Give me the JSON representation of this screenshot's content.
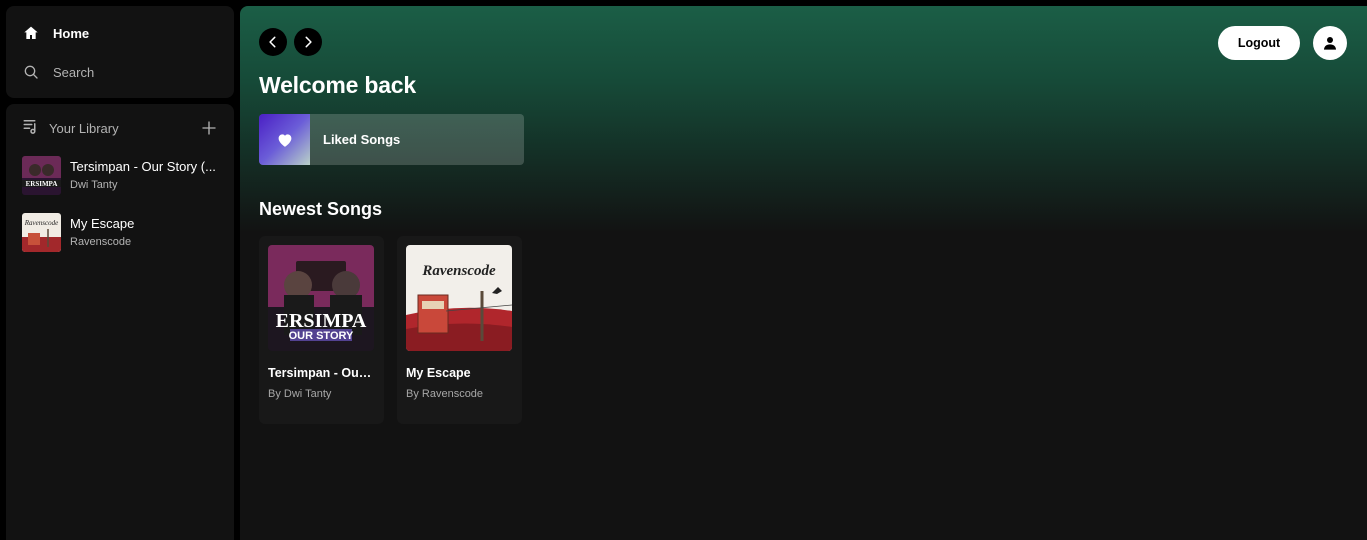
{
  "sidebar": {
    "nav": {
      "home_label": "Home",
      "search_label": "Search"
    },
    "library": {
      "title": "Your Library",
      "items": [
        {
          "title": "Tersimpan - Our Story (...",
          "subtitle": "Dwi Tanty",
          "thumb_text": "ERSIMPA"
        },
        {
          "title": "My Escape",
          "subtitle": "Ravenscode",
          "thumb_text": "Ravenscode"
        }
      ]
    }
  },
  "header": {
    "logout_label": "Logout"
  },
  "main": {
    "greeting": "Welcome back",
    "liked_songs_label": "Liked Songs",
    "newest_title": "Newest Songs",
    "songs": [
      {
        "title": "Tersimpan - Our ...",
        "by": "By Dwi Tanty",
        "art_text_main": "ERSIMPA",
        "art_text_sub": "OUR STORY"
      },
      {
        "title": "My Escape",
        "by": "By Ravenscode",
        "art_text_main": "Ravenscode"
      }
    ]
  },
  "colors": {
    "accent_green": "#1b5e46",
    "surface": "#121212",
    "card": "#181818",
    "muted_text": "#b3b3b3"
  },
  "icons": [
    "home-icon",
    "search-icon",
    "library-icon",
    "plus-icon",
    "chevron-left-icon",
    "chevron-right-icon",
    "user-icon",
    "heart-icon"
  ]
}
